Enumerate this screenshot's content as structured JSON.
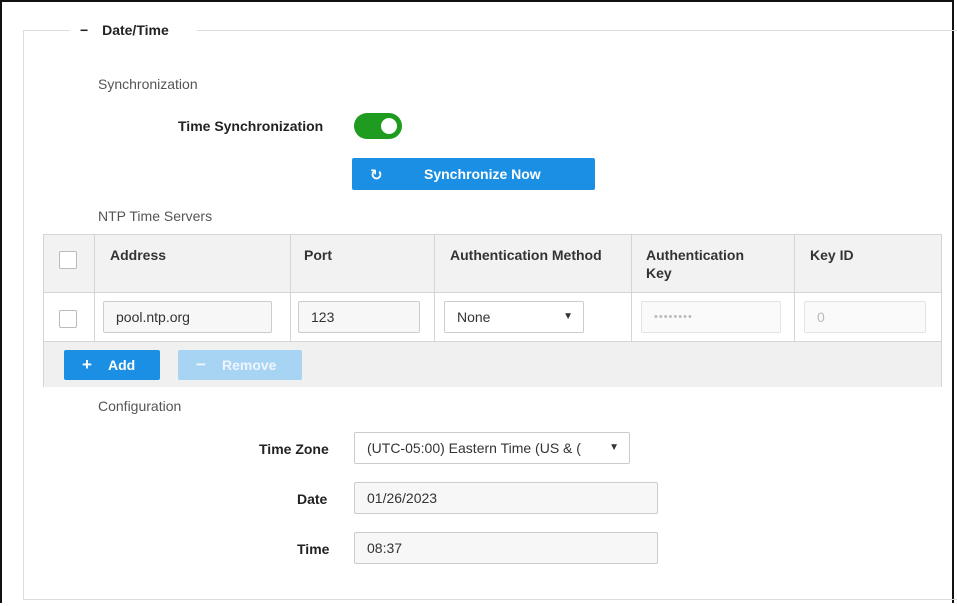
{
  "section": {
    "collapse_symbol": "−",
    "title": "Date/Time"
  },
  "synchronization": {
    "heading": "Synchronization",
    "time_sync_label": "Time Synchronization",
    "toggle_on": true,
    "sync_icon": "refresh-icon",
    "sync_button_label": "Synchronize Now"
  },
  "ntp": {
    "heading": "NTP Time Servers",
    "columns": [
      "Address",
      "Port",
      "Authentication Method",
      "Authentication Key",
      "Key ID"
    ],
    "rows": [
      {
        "address": "pool.ntp.org",
        "port": "123",
        "auth_method": "None",
        "auth_key": "••••••••",
        "key_id": "0"
      }
    ],
    "add_label": "Add",
    "remove_label": "Remove"
  },
  "configuration": {
    "heading": "Configuration",
    "time_zone_label": "Time Zone",
    "time_zone_value": "(UTC-05:00) Eastern Time (US & (",
    "date_label": "Date",
    "date_value": "01/26/2023",
    "time_label": "Time",
    "time_value": "08:37"
  },
  "colors": {
    "primary": "#1a8fe3",
    "toggle_on": "#1f9c1f",
    "disabled_button": "#a8d4f4"
  }
}
